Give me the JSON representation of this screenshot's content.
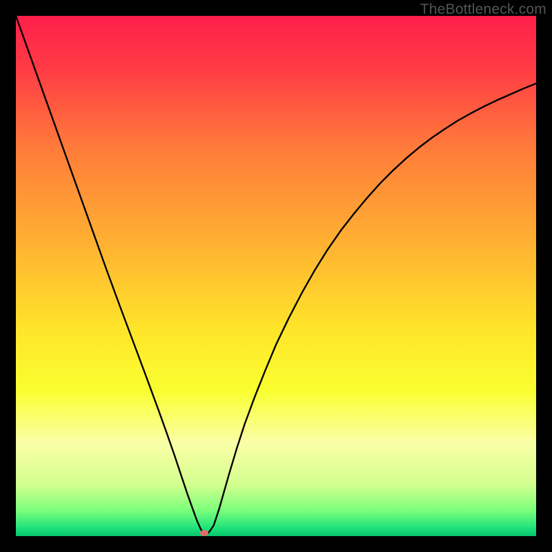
{
  "watermark": "TheBottleneck.com",
  "chart_data": {
    "type": "line",
    "title": "",
    "xlabel": "",
    "ylabel": "",
    "xlim": [
      0,
      100
    ],
    "ylim": [
      0,
      100
    ],
    "background_gradient": {
      "stops": [
        {
          "offset": 0.0,
          "color": "#ff1f4a"
        },
        {
          "offset": 0.1,
          "color": "#ff3b45"
        },
        {
          "offset": 0.25,
          "color": "#ff7a3a"
        },
        {
          "offset": 0.45,
          "color": "#ffb531"
        },
        {
          "offset": 0.6,
          "color": "#ffe42a"
        },
        {
          "offset": 0.72,
          "color": "#f9ff2f"
        },
        {
          "offset": 0.82,
          "color": "#faffa6"
        },
        {
          "offset": 0.9,
          "color": "#d4ff8f"
        },
        {
          "offset": 0.95,
          "color": "#7cff7c"
        },
        {
          "offset": 0.985,
          "color": "#1de27a"
        },
        {
          "offset": 1.0,
          "color": "#06c46c"
        }
      ]
    },
    "series": [
      {
        "name": "bottleneck-curve",
        "color": "#000000",
        "width": 2.4,
        "x": [
          0.0,
          2.5,
          5.0,
          7.5,
          10.0,
          12.5,
          15.0,
          17.5,
          20.0,
          22.5,
          25.0,
          27.5,
          29.0,
          30.5,
          32.0,
          33.0,
          34.0,
          34.8,
          35.5,
          36.0,
          37.0,
          38.0,
          39.0,
          40.0,
          41.0,
          42.5,
          44.0,
          46.0,
          48.0,
          50.0,
          52.5,
          55.0,
          57.5,
          60.0,
          62.5,
          65.0,
          67.5,
          70.0,
          72.5,
          75.0,
          77.5,
          80.0,
          82.5,
          85.0,
          87.5,
          90.0,
          92.5,
          95.0,
          97.5,
          100.0
        ],
        "values": [
          100.0,
          93.0,
          86.0,
          79.0,
          72.0,
          65.0,
          58.0,
          51.0,
          44.2,
          37.5,
          30.8,
          24.0,
          19.8,
          15.5,
          11.0,
          8.0,
          5.2,
          3.0,
          1.4,
          0.6,
          0.6,
          2.0,
          5.0,
          8.5,
          12.0,
          17.0,
          21.6,
          27.0,
          32.0,
          36.8,
          42.0,
          46.8,
          51.2,
          55.2,
          58.8,
          62.0,
          65.0,
          67.8,
          70.3,
          72.6,
          74.7,
          76.6,
          78.3,
          79.9,
          81.3,
          82.6,
          83.8,
          84.9,
          86.0,
          87.0
        ]
      }
    ],
    "marker": {
      "x": 36.2,
      "y": 0.6,
      "color": "#e26a6a",
      "rx": 6,
      "ry": 4.5
    }
  }
}
